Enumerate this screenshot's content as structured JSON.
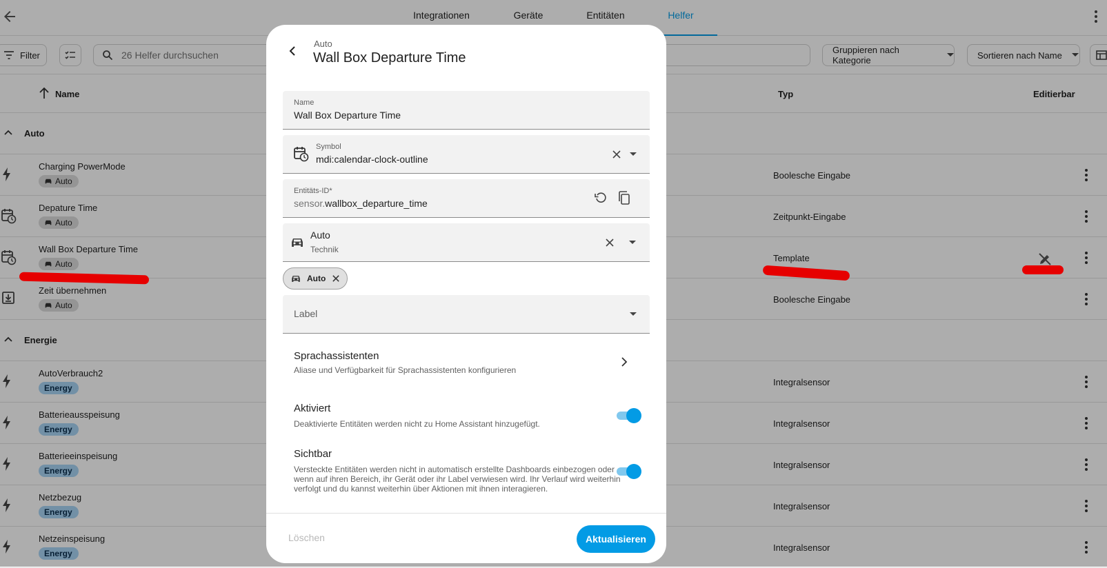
{
  "topbar": {
    "tabs": [
      {
        "label": "Integrationen"
      },
      {
        "label": "Geräte"
      },
      {
        "label": "Entitäten"
      },
      {
        "label": "Helfer"
      }
    ]
  },
  "toolbar": {
    "filter_label": "Filter",
    "search_placeholder": "26 Helfer durchsuchen",
    "group_label": "Gruppieren nach Kategorie",
    "sort_label": "Sortieren nach Name"
  },
  "table": {
    "col_name": "Name",
    "col_type": "Typ",
    "col_editable": "Editierbar",
    "groups": [
      {
        "label": "Auto",
        "rows": [
          {
            "name": "Charging PowerMode",
            "chip": "Auto",
            "type": "Boolesche Eingabe",
            "icon": "flash-icon"
          },
          {
            "name": "Depature Time",
            "chip": "Auto",
            "type": "Zeitpunkt-Eingabe",
            "icon": "calendar-clock-icon"
          },
          {
            "name": "Wall Box Departure Time",
            "chip": "Auto",
            "type": "Template",
            "icon": "calendar-clock-icon"
          },
          {
            "name": "Zeit übernehmen",
            "chip": "Auto",
            "type": "Boolesche Eingabe",
            "icon": "download-box-icon"
          }
        ]
      },
      {
        "label": "Energie",
        "rows": [
          {
            "name": "AutoVerbrauch2",
            "chip": "Energy",
            "type": "Integralsensor",
            "icon": "flash-icon"
          },
          {
            "name": "Batterieausspeisung",
            "chip": "Energy",
            "type": "Integralsensor",
            "icon": "flash-icon"
          },
          {
            "name": "Batterieeinspeisung",
            "chip": "Energy",
            "type": "Integralsensor",
            "icon": "flash-icon"
          },
          {
            "name": "Netzbezug",
            "chip": "Energy",
            "type": "Integralsensor",
            "icon": "flash-icon"
          },
          {
            "name": "Netzeinspeisung",
            "chip": "Energy",
            "type": "Integralsensor",
            "icon": "flash-icon"
          }
        ]
      }
    ]
  },
  "dialog": {
    "subtitle": "Auto",
    "title": "Wall Box Departure Time",
    "name_label": "Name",
    "name_value": "Wall Box Departure Time",
    "symbol_label": "Symbol",
    "symbol_value": "mdi:calendar-clock-outline",
    "entity_id_label": "Entitäts-ID*",
    "entity_id_prefix": "sensor.",
    "entity_id_value": "wallbox_departure_time",
    "area_value": "Auto",
    "area_sub": "Technik",
    "chip_label": "Auto",
    "label_field": "Label",
    "voice_title": "Sprachassistenten",
    "voice_sub": "Aliase und Verfügbarkeit für Sprachassistenten konfigurieren",
    "enabled_title": "Aktiviert",
    "enabled_sub": "Deaktivierte Entitäten werden nicht zu Home Assistant hinzugefügt.",
    "visible_title": "Sichtbar",
    "visible_sub": "Versteckte Entitäten werden nicht in automatisch erstellte Dashboards einbezogen oder wenn auf ihren Bereich, ihr Gerät oder ihr Label verwiesen wird. Ihr Verlauf wird weiterhin verfolgt und du kannst weiterhin über Aktionen mit ihnen interagieren.",
    "delete_label": "Löschen",
    "update_label": "Aktualisieren"
  },
  "colors": {
    "accent": "#039be5",
    "scribble": "#e60000",
    "chip_energy": "#a8d4f5"
  }
}
